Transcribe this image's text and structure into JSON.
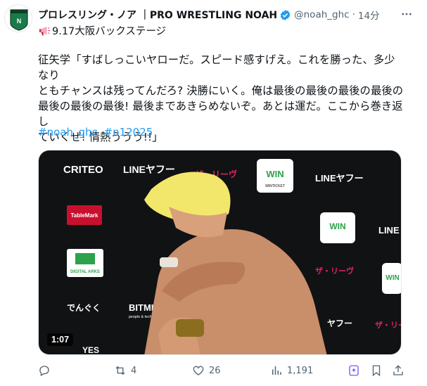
{
  "tweet": {
    "display_name": "プロレスリング・ノア ｜PRO WRESTLING NOAH",
    "handle": "@noah_ghc",
    "separator": "·",
    "time": "14分",
    "first_line": "9.17大阪バックステージ",
    "body_lines": [
      "征矢学「すばしっこいヤローだ。スピード感すげえ。これを勝った、多少なり",
      "ともチャンスは残ってんだろ? 決勝にいく。俺は最後の最後の最後の最後の",
      "最後の最後の最後! 最後まであきらめないぞ。あとは運だ。ここから巻き返し",
      "ていくぜ! 情熱ううう!!」"
    ],
    "hashtags": [
      "#noah_ghc",
      "#n12025"
    ]
  },
  "media": {
    "duration": "1:07",
    "banner_texts": [
      "CRITEO",
      "LINEヤフー",
      "ザ・リーヴ",
      "WIN",
      "WINTICKET",
      "LINEヤフー",
      "TableMark",
      "DIGITAL ARKS",
      "BITMIX",
      "people & technology",
      "でんぐく",
      "YES",
      "ヤフー",
      "LINE"
    ]
  },
  "actions": {
    "reply_count": "",
    "repost_count": "4",
    "like_count": "26",
    "views_count": "1,191"
  },
  "colors": {
    "link": "#1d9bf0",
    "muted": "#536471",
    "verified": "#1d9bf0",
    "logo_green": "#1b7a4a"
  },
  "icons": [
    "noah-logo-icon",
    "verified-icon",
    "more-icon",
    "megaphone-icon",
    "reply-icon",
    "repost-icon",
    "like-icon",
    "views-icon",
    "grok-icon",
    "bookmark-icon",
    "share-icon"
  ]
}
